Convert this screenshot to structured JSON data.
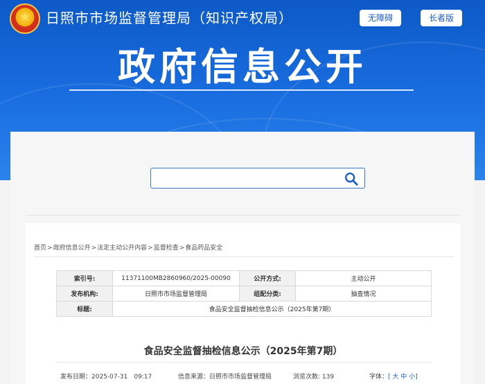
{
  "header": {
    "site_title": "日照市市场监督管理局（知识产权局）",
    "accessibility_button": "无障碍",
    "elderly_button": "长者版",
    "banner_title": "政府信息公开"
  },
  "search": {
    "placeholder": "",
    "value": ""
  },
  "breadcrumb": {
    "items": [
      "首页",
      "政府信息公开",
      "法定主动公开内容",
      "监督检查",
      "食品药品安全"
    ],
    "separator": ">"
  },
  "meta_table": {
    "rows": [
      [
        {
          "k": "索引号:"
        },
        {
          "v": "11371100MB2860960/2025-00090"
        },
        {
          "k": "公开方式:"
        },
        {
          "v": "主动公开"
        }
      ],
      [
        {
          "k": "发布机构:"
        },
        {
          "v": "日照市市场监督管理局"
        },
        {
          "k": "组配分类:"
        },
        {
          "v": "抽查情况"
        }
      ],
      [
        {
          "k": "标题:"
        },
        {
          "v": "食品安全监督抽检信息公示（2025年第7期）"
        }
      ]
    ]
  },
  "article": {
    "title": "食品安全监督抽检信息公示（2025年第7期）",
    "publish_date_label": "发布日期：",
    "publish_date": "2025-07-31　09:17",
    "source_label": "信息来源：",
    "source": "日照市市场监督管理局",
    "views_label": "浏览次数:",
    "views": "139",
    "font_label": "字体：",
    "font_open": "[",
    "font_large": "大",
    "font_medium": "中",
    "font_small": "小",
    "font_close": "]"
  },
  "colors": {
    "banner": "#1a6ee0",
    "link": "#1b5cc0"
  },
  "icons": {
    "search": "search-icon",
    "emblem": "national-emblem-icon"
  }
}
